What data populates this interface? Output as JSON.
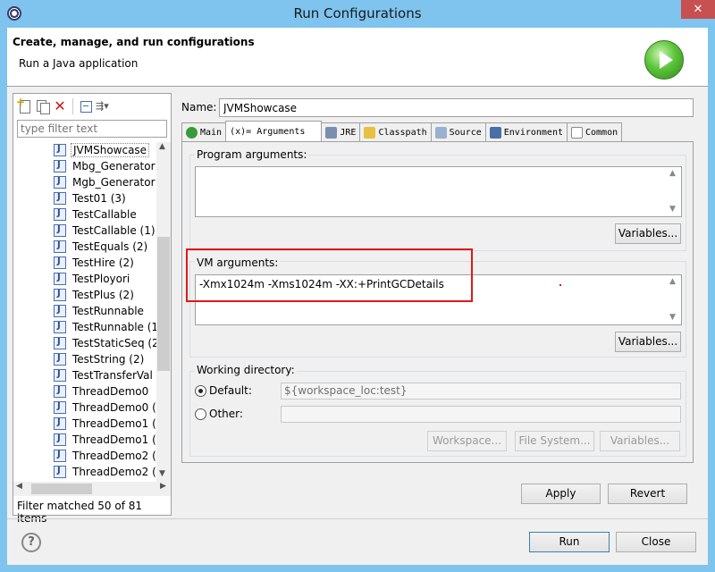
{
  "window": {
    "title": "Run Configurations",
    "close": "✕"
  },
  "header": {
    "title": "Create, manage, and run configurations",
    "subtitle": "Run a Java application"
  },
  "left": {
    "filter_placeholder": "type filter text",
    "tree": [
      "JVMShowcase",
      "Mbg_Generator",
      "Mgb_Generator",
      "Test01 (3)",
      "TestCallable",
      "TestCallable (1)",
      "TestEquals (2)",
      "TestHire (2)",
      "TestPloyori",
      "TestPlus (2)",
      "TestRunnable",
      "TestRunnable (1",
      "TestStaticSeq (2",
      "TestString (2)",
      "TestTransferVal",
      "ThreadDemo0",
      "ThreadDemo0 (",
      "ThreadDemo1 (",
      "ThreadDemo1 (",
      "ThreadDemo2 (",
      "ThreadDemo2 ("
    ],
    "status": "Filter matched 50 of 81 items"
  },
  "name": {
    "label": "Name:",
    "value": "JVMShowcase"
  },
  "tabs": [
    "Main",
    "(x)= Arguments",
    "JRE",
    "Classpath",
    "Source",
    "Environment",
    "Common"
  ],
  "program_args": {
    "label": "Program arguments:",
    "value": "",
    "variables": "Variables..."
  },
  "vm_args": {
    "label": "VM arguments:",
    "value": "-Xmx1024m -Xms1024m -XX:+PrintGCDetails",
    "variables": "Variables..."
  },
  "working_dir": {
    "label": "Working directory:",
    "default_label": "Default:",
    "default_value": "${workspace_loc:test}",
    "other_label": "Other:",
    "workspace": "Workspace...",
    "file_system": "File System...",
    "variables": "Variables..."
  },
  "actions": {
    "apply": "Apply",
    "revert": "Revert",
    "run": "Run",
    "close": "Close"
  },
  "help": "?"
}
